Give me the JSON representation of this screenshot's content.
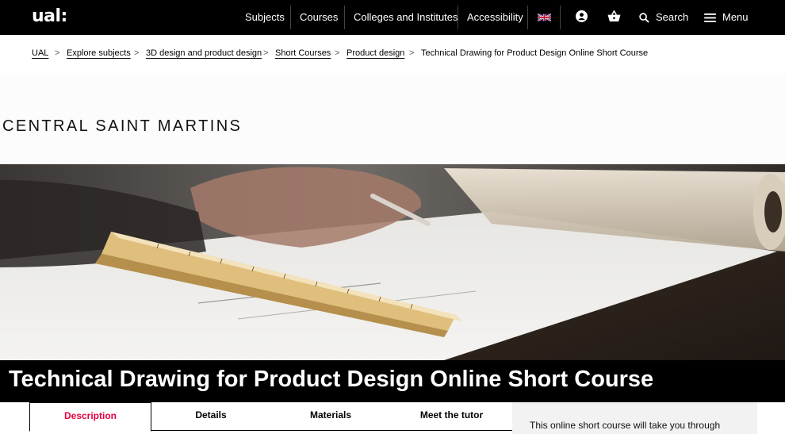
{
  "header": {
    "logo": "ual:",
    "nav": [
      "Subjects",
      "Courses",
      "Colleges and Institutes",
      "Accessibility"
    ],
    "search_label": "Search",
    "menu_label": "Menu",
    "icons": [
      "uk-flag-icon",
      "account-icon",
      "basket-icon",
      "search-icon",
      "menu-icon"
    ]
  },
  "breadcrumb": {
    "items": [
      "UAL",
      "Explore subjects",
      "3D design and product design",
      "Short Courses",
      "Product design"
    ],
    "current": "Technical Drawing for Product Design Online Short Course",
    "separator": ">"
  },
  "school": {
    "name": "CENTRAL SAINT MARTINS"
  },
  "course": {
    "title": "Technical Drawing for Product Design Online Short Course"
  },
  "tabs": {
    "items": [
      "Description",
      "Details",
      "Materials",
      "Meet the tutor"
    ],
    "active": "Description"
  },
  "side_panel": {
    "text": "This online short course will take you through"
  },
  "colors": {
    "nav_bg": "#000000",
    "accent": "#e4003a",
    "panel_bg": "#f2f2f2"
  }
}
